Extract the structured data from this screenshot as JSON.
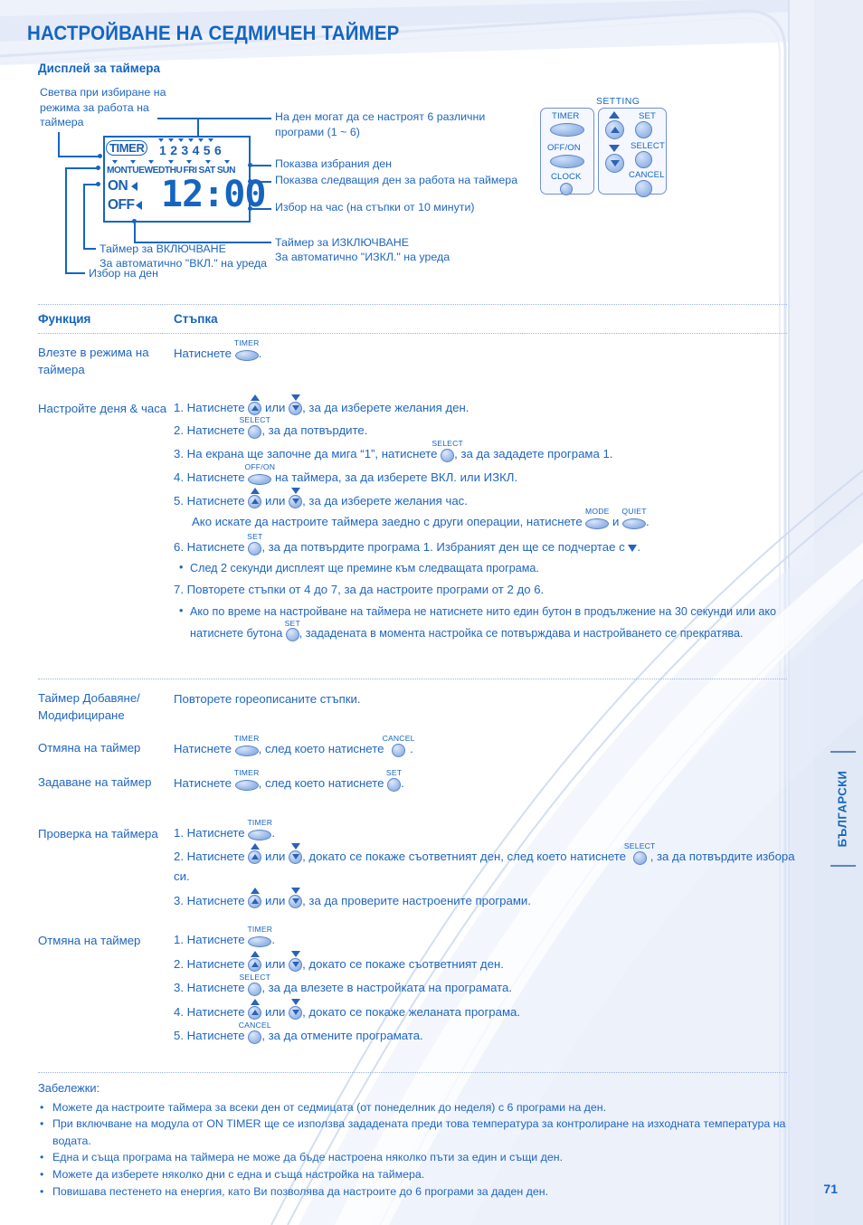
{
  "page": {
    "title": "НАСТРОЙВАНЕ НА СЕДМИЧЕН ТАЙМЕР",
    "section_title": "Дисплей за таймера",
    "page_number": "71",
    "language_tab": "БЪЛГАРСКИ",
    "accent_color": "#1565c0",
    "button_color": "#9dbbe8"
  },
  "diagram": {
    "lcd": {
      "timer_badge": "TIMER",
      "program_numbers": [
        "1",
        "2",
        "3",
        "4",
        "5",
        "6"
      ],
      "days": [
        "MON",
        "TUE",
        "WED",
        "THU",
        "FRI",
        "SAT",
        "SUN"
      ],
      "on_label": "ON",
      "off_label": "OFF",
      "clock_value": "12:00"
    },
    "callouts": {
      "left_top": "Светва при избиране на режима за работа на таймера",
      "right_1": "На ден могат да се настроят 6 различни програми (1 ~ 6)",
      "right_2": "Показва избрания ден",
      "right_3": "Показва следващия ден за работа на таймера",
      "right_4": "Избор на час (на стъпки от 10 минути)",
      "right_5_line1": "Таймер за ИЗКЛЮЧВАНЕ",
      "right_5_line2": "За автоматично \"ИЗКЛ.\" на уреда",
      "bottom_1_line1": "Таймер за ВКЛЮЧВАНЕ",
      "bottom_1_line2": "За автоматично \"ВКЛ.\" на уреда",
      "bottom_2": "Избор на ден"
    },
    "remote": {
      "setting_label": "SETTING",
      "buttons": {
        "timer": "TIMER",
        "off_on": "OFF/ON",
        "clock": "CLOCK",
        "up": "▲",
        "down": "▼",
        "set": "SET",
        "select": "SELECT",
        "cancel": "CANCEL"
      }
    }
  },
  "table": {
    "header": {
      "function": "Функция",
      "step": "Стъпка"
    },
    "rows": [
      {
        "function": "Влезте в режима на таймера",
        "steps": [
          {
            "prefix": "Натиснете ",
            "button": "TIMER",
            "button_shape": "oval",
            "suffix": "."
          }
        ]
      },
      {
        "function": "Настройте деня & часа",
        "steps": [
          {
            "num": "1.",
            "prefix": "Натиснете ",
            "a": "up",
            "mid": " или ",
            "b": "down",
            "suffix": ", за да изберете желания ден."
          },
          {
            "num": "2.",
            "prefix": "Натиснете ",
            "button": "SELECT",
            "button_shape": "round",
            "suffix": ", за да потвърдите."
          },
          {
            "num": "3.",
            "prefix": "На екрана ще започне да мига “1”, натиснете ",
            "button": "SELECT",
            "button_shape": "round",
            "suffix": ", за да зададете програма 1."
          },
          {
            "num": "4.",
            "prefix": "Натиснете ",
            "button": "OFF/ON",
            "button_shape": "oval",
            "suffix": " на таймера, за да изберете ВКЛ. или ИЗКЛ."
          },
          {
            "num": "5.",
            "prefix": "Натиснете ",
            "a": "up",
            "mid": " или ",
            "b": "down",
            "suffix": ", за да изберете желания час."
          },
          {
            "cont": true,
            "prefix": "Ако искате да настроите таймера заедно с други операции, натиснете ",
            "button": "MODE",
            "button_shape": "oval",
            "mid": " и ",
            "button2": "QUIET",
            "button2_shape": "oval",
            "suffix": "."
          },
          {
            "num": "6.",
            "prefix": "Натиснете ",
            "button": "SET",
            "button_shape": "round",
            "suffix": ", за да потвърдите програма 1. Избраният ден ще се подчертае с ",
            "has_tri": true,
            "tail": "."
          },
          {
            "bullet": true,
            "text": "След 2 секунди дисплеят ще премине към следващата програма."
          },
          {
            "num": "7.",
            "text": "Повторете стъпки от 4 до 7, за да настроите програми от 2 до 6."
          },
          {
            "bullet": true,
            "prefix": "Ако по време на настройване на таймера не натиснете нито един бутон в продължение на 30 секунди или ако натиснете бутона ",
            "button": "SET",
            "button_shape": "round",
            "suffix": ", зададената в момента настройка се потвърждава и настройването се прекратява."
          }
        ]
      },
      {
        "function": "Таймер Добавяне/ Модифициране",
        "steps": [
          {
            "text": "Повторете гореописаните стъпки."
          }
        ]
      },
      {
        "function": "Отмяна на таймер",
        "steps": [
          {
            "prefix": "Натиснете ",
            "button": "TIMER",
            "button_shape": "oval",
            "mid": ", след което натиснете ",
            "button2": "CANCEL",
            "button2_shape": "round",
            "suffix": "."
          }
        ]
      },
      {
        "function": "Задаване на таймер",
        "steps": [
          {
            "prefix": "Натиснете ",
            "button": "TIMER",
            "button_shape": "oval",
            "mid": ", след което натиснете ",
            "button2": "SET",
            "button2_shape": "round",
            "suffix": "."
          }
        ]
      },
      {
        "function": "Проверка на таймера",
        "steps": [
          {
            "num": "1.",
            "prefix": "Натиснете ",
            "button": "TIMER",
            "button_shape": "oval",
            "suffix": "."
          },
          {
            "num": "2.",
            "prefix": "Натиснете ",
            "a": "up",
            "mid": " или ",
            "b": "down",
            "suffix": ", докато се покаже съответният ден, след което натиснете ",
            "button2": "SELECT",
            "button2_shape": "round",
            "tail": ", за да потвърдите избора си."
          },
          {
            "num": "3.",
            "prefix": "Натиснете ",
            "a": "up",
            "mid": " или ",
            "b": "down",
            "suffix": ", за да проверите настроените програми."
          }
        ]
      },
      {
        "function": "Отмяна на таймер",
        "steps": [
          {
            "num": "1.",
            "prefix": "Натиснете ",
            "button": "TIMER",
            "button_shape": "oval",
            "suffix": "."
          },
          {
            "num": "2.",
            "prefix": "Натиснете ",
            "a": "up",
            "mid": " или ",
            "b": "down",
            "suffix": ", докато се покаже съответният ден."
          },
          {
            "num": "3.",
            "prefix": "Натиснете ",
            "button": "SELECT",
            "button_shape": "round",
            "suffix": ", за да влезете в настройката на програмата."
          },
          {
            "num": "4.",
            "prefix": "Натиснете ",
            "a": "up",
            "mid": " или ",
            "b": "down",
            "suffix": ", докато се покаже желаната програма."
          },
          {
            "num": "5.",
            "prefix": "Натиснете ",
            "button": "CANCEL",
            "button_shape": "round",
            "suffix": ", за да отмените програмата."
          }
        ]
      }
    ]
  },
  "notes": {
    "heading": "Забележки:",
    "items": [
      "Можете да настроите таймера за всеки ден от седмицата (от понеделник до неделя) с 6 програми на ден.",
      "При включване на модула от ON TIMER ще се използва зададената преди това температура за контролиране на изходната температура на водата.",
      "Една и съща програма на таймера не може да бъде настроена няколко пъти за един и същи ден.",
      "Можете да изберете няколко дни с една и съща настройка на таймера.",
      "Повишава пестенето на енергия, като Ви позволява да настроите до 6 програми за даден ден."
    ]
  }
}
